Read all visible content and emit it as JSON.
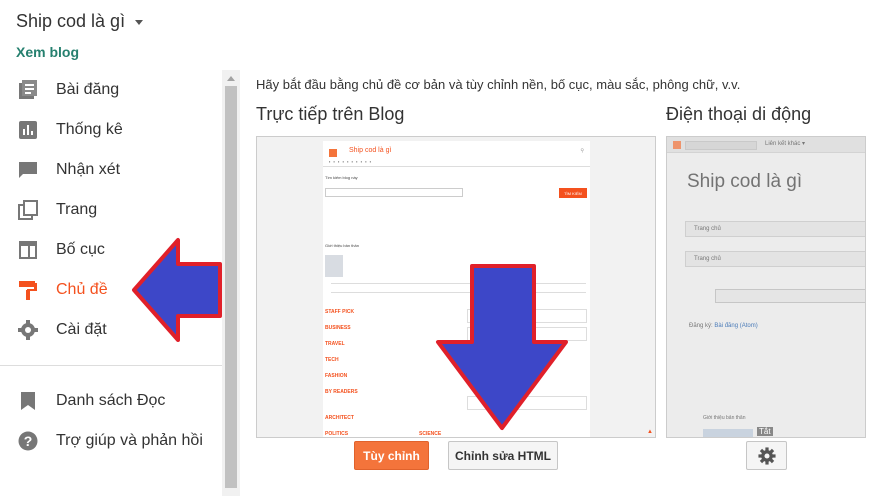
{
  "header": {
    "blog_title": "Ship cod là gì",
    "view_blog": "Xem blog"
  },
  "sidebar": {
    "items": [
      {
        "label": "Bài đăng",
        "icon": "posts-icon",
        "active": false
      },
      {
        "label": "Thống kê",
        "icon": "stats-icon",
        "active": false
      },
      {
        "label": "Nhận xét",
        "icon": "comments-icon",
        "active": false
      },
      {
        "label": "Trang",
        "icon": "pages-icon",
        "active": false
      },
      {
        "label": "Bố cục",
        "icon": "layout-icon",
        "active": false
      },
      {
        "label": "Chủ đề",
        "icon": "theme-roller-icon",
        "active": true
      },
      {
        "label": "Cài đặt",
        "icon": "gear-icon",
        "active": false
      }
    ],
    "secondary": [
      {
        "label": "Danh sách Đọc",
        "icon": "bookmark-icon"
      },
      {
        "label": "Trợ giúp và phản hồi",
        "icon": "help-icon"
      }
    ]
  },
  "main": {
    "intro": "Hãy bắt đầu bằng chủ đề cơ bản và tùy chỉnh nền, bố cục, màu sắc, phông chữ, v.v.",
    "live_title": "Trực tiếp trên Blog",
    "mobile_title": "Điện thoại di động",
    "customize_button": "Tùy chỉnh",
    "edit_html_button": "Chỉnh sửa HTML"
  },
  "preview": {
    "blog_name": "Ship cod là gì",
    "search_label": "Tìm kiếm blog này",
    "search_button": "TÌM KIẾM",
    "about_label": "Giới thiệu bản thân",
    "categories": [
      "STAFF PICK",
      "BUSINESS",
      "TRAVEL",
      "TECH",
      "FASHION",
      "BY READERS",
      "ARCHITECT",
      "POLITICS",
      "SCIENCE"
    ]
  },
  "mobile_preview": {
    "blog_name": "Ship cod là gì",
    "more_links": "Liên kết khác ▾",
    "home_label": "Trang chủ",
    "post_text": "Đăng ký: ",
    "post_link": "Bài đăng (Atom)",
    "profile_label": "Giới thiệu bản thân",
    "close_label": "Tắt"
  },
  "colors": {
    "accent": "#f4511e",
    "link_green": "#26806f",
    "arrow_fill": "#3d47c8",
    "arrow_stroke": "#e0202a"
  }
}
